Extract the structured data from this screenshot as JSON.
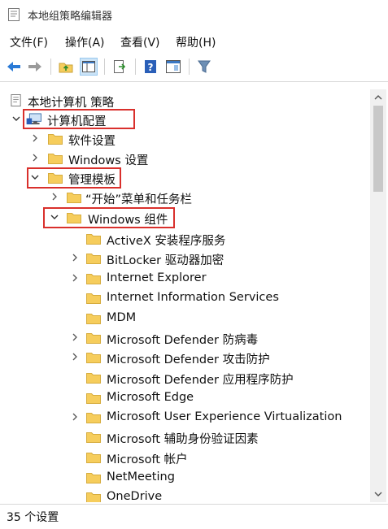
{
  "window": {
    "title": "本地组策略编辑器"
  },
  "menu": [
    "文件(F)",
    "操作(A)",
    "查看(V)",
    "帮助(H)"
  ],
  "toolbar": {
    "buttons": [
      "back-arrow-icon",
      "forward-arrow-icon",
      "up-folder-icon",
      "show-hide-tree-icon",
      "export-list-icon",
      "help-icon",
      "properties-icon",
      "filter-icon"
    ]
  },
  "tree": {
    "root": "本地计算机 策略",
    "computer_config": "计算机配置",
    "software_settings": "软件设置",
    "windows_settings": "Windows 设置",
    "admin_templates": "管理模板",
    "start_menu": "“开始”菜单和任务栏",
    "windows_components": "Windows 组件",
    "components": [
      "ActiveX 安装程序服务",
      "BitLocker 驱动器加密",
      "Internet Explorer",
      "Internet Information Services",
      "MDM",
      "Microsoft Defender 防病毒",
      "Microsoft Defender 攻击防护",
      "Microsoft Defender 应用程序防护",
      "Microsoft Edge",
      "Microsoft User Experience Virtualization",
      "Microsoft 辅助身份验证因素",
      "Microsoft 帐户",
      "NetMeeting",
      "OneDrive"
    ]
  },
  "status": {
    "text": "35 个设置"
  },
  "colors": {
    "highlight_border": "#d9302c",
    "folder": "#f6cd5c",
    "selection": "#cce4f7"
  }
}
